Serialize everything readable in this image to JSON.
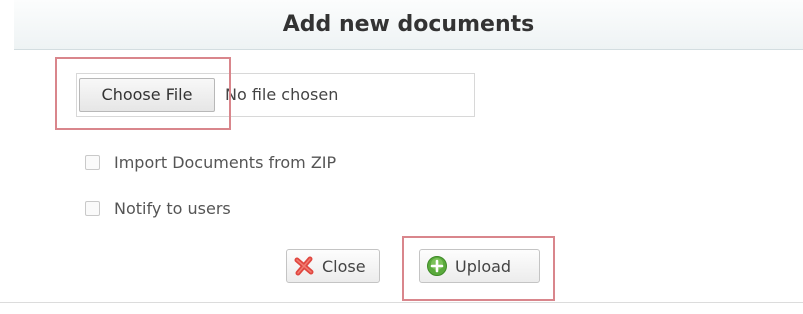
{
  "dialog": {
    "title": "Add new documents"
  },
  "file_input": {
    "button_label": "Choose File",
    "status_text": "No file chosen"
  },
  "options": [
    {
      "label": "Import Documents from ZIP",
      "checked": false
    },
    {
      "label": "Notify to users",
      "checked": false
    }
  ],
  "actions": {
    "close_label": "Close",
    "upload_label": "Upload"
  },
  "icons": {
    "close": "x-icon",
    "upload": "plus-circle-icon"
  },
  "colors": {
    "highlight": "#d9868c",
    "close_icon": "#e0463f",
    "upload_icon": "#5aaa3c"
  }
}
